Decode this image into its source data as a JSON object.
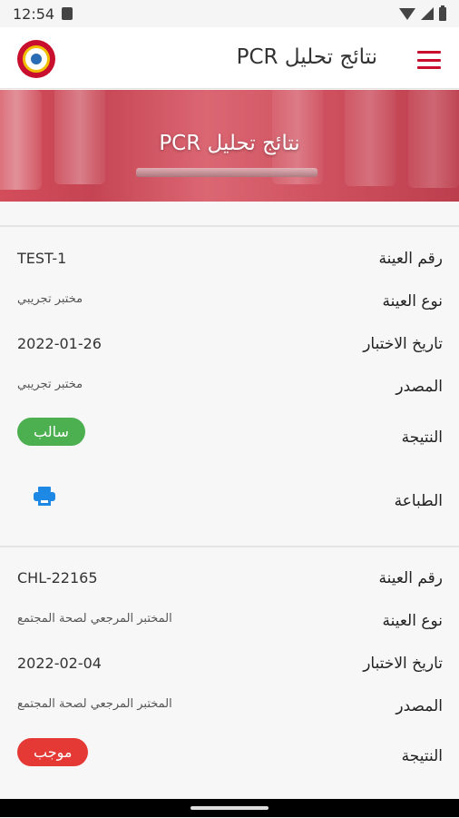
{
  "status_bar": {
    "time": "12:54",
    "icons": [
      "sim-icon",
      "wifi-icon",
      "signal-icon",
      "battery-icon"
    ]
  },
  "app_bar": {
    "title": "نتائج تحليل PCR",
    "logo": "logo-icon",
    "menu": "menu-icon"
  },
  "banner": {
    "title": "نتائج تحليل PCR"
  },
  "labels": {
    "sample_number": "رقم العينة",
    "sample_type": "نوع العينة",
    "test_date": "تاريخ الاختبار",
    "source": "المصدر",
    "result": "النتيجة",
    "print": "الطباعة"
  },
  "results": [
    {
      "sample_number": "TEST-1",
      "sample_type": "مختبر تجريبي",
      "test_date": "2022-01-26",
      "source": "مختبر تجريبي",
      "result": "سالب",
      "result_color": "#4caf50"
    },
    {
      "sample_number": "CHL-22165",
      "sample_type": "المختبر المرجعي لصحة المجتمع",
      "test_date": "2022-02-04",
      "source": "المختبر المرجعي لصحة المجتمع",
      "result": "موجب",
      "result_color": "#e53935"
    }
  ],
  "colors": {
    "accent": "#c8102e",
    "print_icon": "#1e88e5"
  }
}
